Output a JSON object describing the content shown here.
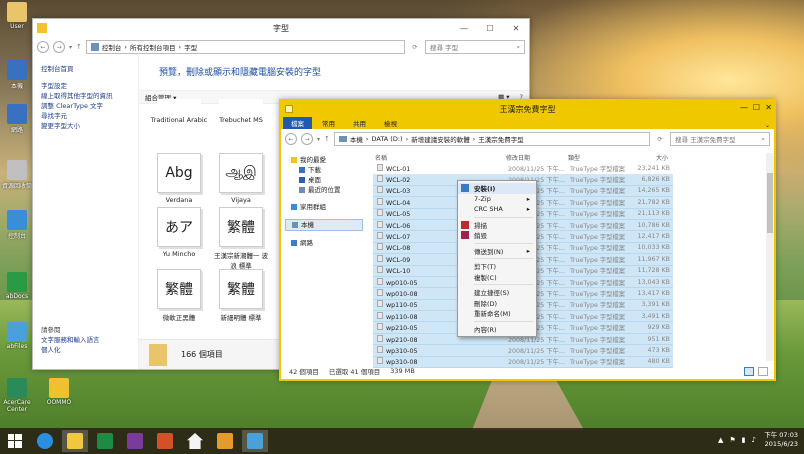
{
  "desktop": {
    "icons": [
      {
        "label": "User"
      },
      {
        "label": "本機"
      },
      {
        "label": "網路"
      },
      {
        "label": "資源回收筒"
      },
      {
        "label": "控制台"
      },
      {
        "label": "abDocs"
      },
      {
        "label": "abFiles"
      },
      {
        "label": "AcerCare Center"
      },
      {
        "label": "OOMMO"
      }
    ]
  },
  "fonts_window": {
    "title": "字型",
    "breadcrumb": [
      "控制台",
      "所有控制台項目",
      "字型"
    ],
    "search_placeholder": "搜尋 字型",
    "left_links": {
      "home": "控制台首頁",
      "items": [
        "字型設定",
        "線上取得其他字型的資訊",
        "調整 ClearType 文字",
        "尋找字元",
        "變更字型大小"
      ],
      "see_also_heading": "請參閱",
      "see_also": [
        "文字服務和輸入語言",
        "個人化"
      ]
    },
    "description": "預覽，刪除或顯示和隱藏電腦安裝的字型",
    "toolbar_organize": "組合管理 ▾",
    "fonts": [
      {
        "name": "Traditional Arabic",
        "glyph": ""
      },
      {
        "name": "Trebuchet MS",
        "glyph": ""
      },
      {
        "name": "Verdana",
        "glyph": "Abg"
      },
      {
        "name": "Vijaya",
        "glyph": "ஆஇ"
      },
      {
        "name": "Yu Mincho",
        "glyph": "あア"
      },
      {
        "name": "王漢宗新潮體一 波浪 標準",
        "glyph": "繁體"
      },
      {
        "name": "微軟正黑體",
        "glyph": "繁體"
      },
      {
        "name": "新細明體 標準",
        "glyph": "繁體"
      }
    ],
    "status_count": "166 個項目"
  },
  "folder_window": {
    "title": "王漢宗免費字型",
    "ribbon_tabs": [
      "檔案",
      "常用",
      "共用",
      "檢視"
    ],
    "breadcrumb": [
      "本機",
      "DATA (D:)",
      "新增建議安裝的軟體",
      "王漢宗免費字型"
    ],
    "search_placeholder": "搜尋 王漢宗免費字型",
    "nav": [
      {
        "label": "我的最愛",
        "level": 0,
        "color": "#f2c230"
      },
      {
        "label": "下載",
        "level": 1,
        "color": "#3b6fc4"
      },
      {
        "label": "桌面",
        "level": 1,
        "color": "#2b5fb4"
      },
      {
        "label": "最近的位置",
        "level": 1,
        "color": "#6c8cb8"
      },
      {
        "label": "家用群組",
        "level": 0,
        "color": "#3a8ed8"
      },
      {
        "label": "本機",
        "level": 0,
        "color": "#6e8fb6",
        "selected": true
      },
      {
        "label": "網路",
        "level": 0,
        "color": "#3e7bc6"
      }
    ],
    "columns": {
      "name": "名稱",
      "date": "修改日期",
      "type": "類型",
      "size": "大小"
    },
    "files": [
      {
        "name": "WCL-01",
        "date": "2008/11/25 下午...",
        "type": "TrueType 字型檔案",
        "size": "23,241 KB",
        "selected": false
      },
      {
        "name": "WCL-02",
        "date": "2008/11/25 下午...",
        "type": "TrueType 字型檔案",
        "size": "6,826 KB",
        "selected": true
      },
      {
        "name": "WCL-03",
        "date": "2008/11/25 下午...",
        "type": "TrueType 字型檔案",
        "size": "14,265 KB",
        "selected": true
      },
      {
        "name": "WCL-04",
        "date": "2008/11/25 下午...",
        "type": "TrueType 字型檔案",
        "size": "21,782 KB",
        "selected": true
      },
      {
        "name": "WCL-05",
        "date": "2008/11/25 下午...",
        "type": "TrueType 字型檔案",
        "size": "21,113 KB",
        "selected": true
      },
      {
        "name": "WCL-06",
        "date": "2008/11/25 下午...",
        "type": "TrueType 字型檔案",
        "size": "10,786 KB",
        "selected": true
      },
      {
        "name": "WCL-07",
        "date": "2008/11/25 下午...",
        "type": "TrueType 字型檔案",
        "size": "12,417 KB",
        "selected": true
      },
      {
        "name": "WCL-08",
        "date": "2008/11/25 下午...",
        "type": "TrueType 字型檔案",
        "size": "10,033 KB",
        "selected": true
      },
      {
        "name": "WCL-09",
        "date": "2008/11/25 下午...",
        "type": "TrueType 字型檔案",
        "size": "11,967 KB",
        "selected": true
      },
      {
        "name": "WCL-10",
        "date": "2008/11/25 下午...",
        "type": "TrueType 字型檔案",
        "size": "11,728 KB",
        "selected": true
      },
      {
        "name": "wp010-05",
        "date": "2008/11/25 下午...",
        "type": "TrueType 字型檔案",
        "size": "13,043 KB",
        "selected": true
      },
      {
        "name": "wp010-08",
        "date": "2008/11/25 下午...",
        "type": "TrueType 字型檔案",
        "size": "13,417 KB",
        "selected": true
      },
      {
        "name": "wp110-05",
        "date": "2008/11/25 下午...",
        "type": "TrueType 字型檔案",
        "size": "3,391 KB",
        "selected": true
      },
      {
        "name": "wp110-08",
        "date": "2008/11/25 下午...",
        "type": "TrueType 字型檔案",
        "size": "3,491 KB",
        "selected": true
      },
      {
        "name": "wp210-05",
        "date": "2008/11/25 下午...",
        "type": "TrueType 字型檔案",
        "size": "929 KB",
        "selected": true
      },
      {
        "name": "wp210-08",
        "date": "2008/11/25 下午...",
        "type": "TrueType 字型檔案",
        "size": "951 KB",
        "selected": true
      },
      {
        "name": "wp310-05",
        "date": "2008/11/25 下午...",
        "type": "TrueType 字型檔案",
        "size": "473 KB",
        "selected": true
      },
      {
        "name": "wp310-08",
        "date": "2008/11/25 下午...",
        "type": "TrueType 字型檔案",
        "size": "480 KB",
        "selected": true
      }
    ],
    "status": {
      "items": "42 個項目",
      "selected": "已選取 41 個項目",
      "size": "339 MB"
    }
  },
  "context_menu": {
    "items": [
      {
        "label": "安裝(I)",
        "bold": true,
        "icon": "shield-icon"
      },
      {
        "label": "7-Zip",
        "submenu": true
      },
      {
        "label": "CRC SHA",
        "submenu": true
      },
      {
        "sep": true
      },
      {
        "label": "掃描",
        "icon": "scan-icon"
      },
      {
        "label": "銷毀",
        "icon": "shred-icon"
      },
      {
        "sep": true
      },
      {
        "label": "傳送到(N)",
        "submenu": true
      },
      {
        "sep": true
      },
      {
        "label": "剪下(T)"
      },
      {
        "label": "複製(C)"
      },
      {
        "sep": true
      },
      {
        "label": "建立捷徑(S)"
      },
      {
        "label": "刪除(D)"
      },
      {
        "label": "重新命名(M)"
      },
      {
        "sep": true
      },
      {
        "label": "內容(R)"
      }
    ]
  },
  "taskbar": {
    "apps": [
      "ie",
      "explorer",
      "excel",
      "onenote",
      "powerpoint",
      "home",
      "app",
      "fonts"
    ],
    "time": "下午 07:03",
    "date": "2015/6/23"
  }
}
